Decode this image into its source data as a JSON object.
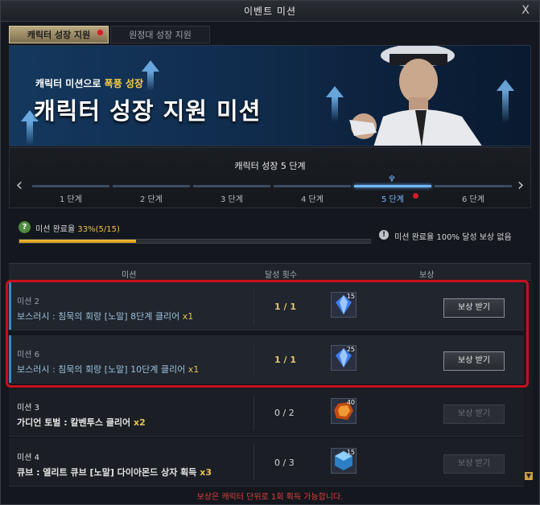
{
  "window": {
    "title": "이벤트 미션",
    "close_label": "X"
  },
  "tabs": [
    {
      "label": "캐릭터 성장 지원",
      "active": true,
      "has_notification": true
    },
    {
      "label": "원정대 성장 지원",
      "active": false,
      "has_notification": false
    }
  ],
  "banner": {
    "subtitle_prefix": "캐릭터 미션으로",
    "subtitle_highlight": "폭풍 성장",
    "title": "캐릭터 성장 지원 미션"
  },
  "stages": {
    "title": "캐릭터 성장 5 단계",
    "steps": [
      "1 단계",
      "2 단계",
      "3 단계",
      "4 단계",
      "5 단계",
      "6 단계"
    ],
    "active_index": 4
  },
  "progress": {
    "label": "미션 완료율",
    "value_text": "33%(5/15)",
    "fraction": 0.333,
    "reward_note": "미션 완료율 100% 달성 보상 없음"
  },
  "table": {
    "headers": {
      "mission": "미션",
      "count": "달성 횟수",
      "reward": "보상"
    }
  },
  "missions": [
    {
      "name": "미션 2",
      "desc": "보스러시 : 침묵의 회랑 [노말] 8단계 클리어",
      "mult": "x1",
      "count": "1 / 1",
      "reward_qty": "15",
      "reward_icon": "blue-crystal-icon",
      "button": "보상 받기",
      "done": true
    },
    {
      "name": "미션 6",
      "desc": "보스러시 : 침묵의 회랑 [노말] 10단계 클리어",
      "mult": "x1",
      "count": "1 / 1",
      "reward_qty": "25",
      "reward_icon": "blue-crystal-icon",
      "button": "보상 받기",
      "done": true
    },
    {
      "name": "미션 3",
      "desc": "가디언 토벌 : 칼벤투스 클리어",
      "mult": "x2",
      "count": "0 / 2",
      "reward_qty": "40",
      "reward_icon": "orange-gem-icon",
      "button": "보상 받기",
      "done": false
    },
    {
      "name": "미션 4",
      "desc": "큐브 : 엘리트 큐브 [노말] 다이아몬드 상자 획득",
      "mult": "x3",
      "count": "0 / 3",
      "reward_qty": "15",
      "reward_icon": "blue-cube-icon",
      "button": "보상 받기",
      "done": false
    }
  ],
  "footer": {
    "note": "보상은 캐릭터 단위로 1회 획득 가능합니다."
  },
  "colors": {
    "accent_gold": "#f2c44d",
    "active_blue": "#71b6ff",
    "highlight_red": "#c8101c"
  }
}
